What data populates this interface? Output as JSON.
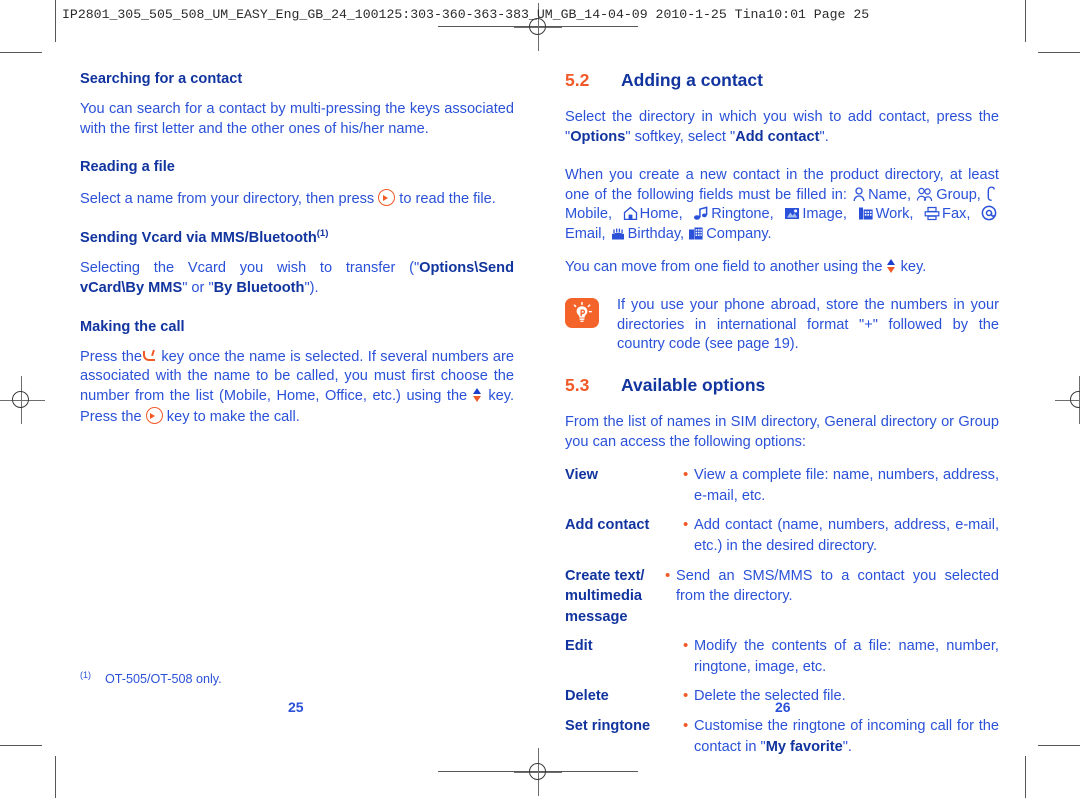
{
  "print_slug": "IP2801_305_505_508_UM_EASY_Eng_GB_24_100125:303-360-363-383_UM_GB_14-04-09   2010-1-25   Tina10:01   Page 25",
  "colors": {
    "body_blue": "#2a51d8",
    "heading_blue": "#11349e",
    "accent_orange": "#f05a28",
    "note_icon_bg": "#f4642a"
  },
  "left_page": {
    "folio": "25",
    "sections": {
      "searching_heading": "Searching for a contact",
      "searching_body": "You can search for a contact by multi-pressing the keys associated with the first letter and the other ones of his/her name.",
      "reading_heading": "Reading a file",
      "reading_body_before": "Select a name from your directory, then press",
      "reading_body_after": "to read the file.",
      "vcard_heading": "Sending Vcard via MMS/Bluetooth",
      "vcard_heading_footnote_mark": "(1)",
      "vcard_body_1": "Selecting the Vcard you wish to transfer (\"",
      "vcard_bold_1": "Options\\Send vCard\\By MMS",
      "vcard_body_2": "\" or \"",
      "vcard_bold_2": "By Bluetooth",
      "vcard_body_3": "\").",
      "call_heading": "Making the call",
      "call_body_1": "Press the",
      "call_body_2": "key once the name is selected. If several numbers are associated with the name to be called, you must first choose the number from the list (Mobile, Home, Office, etc.) using the",
      "call_body_3": "key. Press the",
      "call_body_4": "key to make the call."
    },
    "footnote": {
      "mark": "(1)",
      "text": "OT-505/OT-508 only."
    }
  },
  "right_page": {
    "folio": "26",
    "section_52": {
      "number": "5.2",
      "title": "Adding a contact",
      "intro_1": "Select the directory in which you wish to add contact, press the \"",
      "intro_bold_1": "Options",
      "intro_2": "\" softkey, select \"",
      "intro_bold_2": "Add contact",
      "intro_3": "\".",
      "fields_intro": "When you create a new contact in the product directory, at least one of the following fields must be filled in:",
      "fields": [
        {
          "icon": "person-icon",
          "label": "Name,"
        },
        {
          "icon": "group-icon",
          "label": "Group,"
        },
        {
          "icon": "mobile-icon",
          "label": "Mobile,"
        },
        {
          "icon": "home-icon",
          "label": "Home,"
        },
        {
          "icon": "ringtone-icon",
          "label": "Ringtone,"
        },
        {
          "icon": "image-icon",
          "label": "Image,"
        },
        {
          "icon": "work-icon",
          "label": "Work,"
        },
        {
          "icon": "fax-icon",
          "label": "Fax,"
        },
        {
          "icon": "email-icon",
          "label": "Email,"
        },
        {
          "icon": "birthday-icon",
          "label": "Birthday,"
        },
        {
          "icon": "company-icon",
          "label": "Company."
        }
      ],
      "navigate_before": "You can move from one field to another using the",
      "navigate_after": "key."
    },
    "note": {
      "icon": "lightbulb-tip-icon",
      "text": "If you use your phone abroad, store the numbers in your directories in international format \"+\" followed by the country code (see page 19)."
    },
    "section_53": {
      "number": "5.3",
      "title": "Available options",
      "intro": "From the list of names in SIM directory, General directory or Group you can access the following options:",
      "bullet": "•",
      "options": [
        {
          "term": "View",
          "definition": "View a complete file: name, numbers, address, e-mail, etc."
        },
        {
          "term": "Add contact",
          "definition": "Add contact (name, numbers, address, e-mail, etc.) in the desired directory."
        },
        {
          "term": "Create text/ multimedia message",
          "definition": "Send an SMS/MMS to a contact you selected from the directory."
        },
        {
          "term": "Edit",
          "definition": "Modify the contents of a file: name, number, ringtone, image, etc."
        },
        {
          "term": "Delete",
          "definition": "Delete the selected file."
        },
        {
          "term": "Set ringtone",
          "definition_1": "Customise the ringtone of incoming call for the contact in \"",
          "definition_bold": "My favorite",
          "definition_2": "\"."
        }
      ]
    }
  }
}
